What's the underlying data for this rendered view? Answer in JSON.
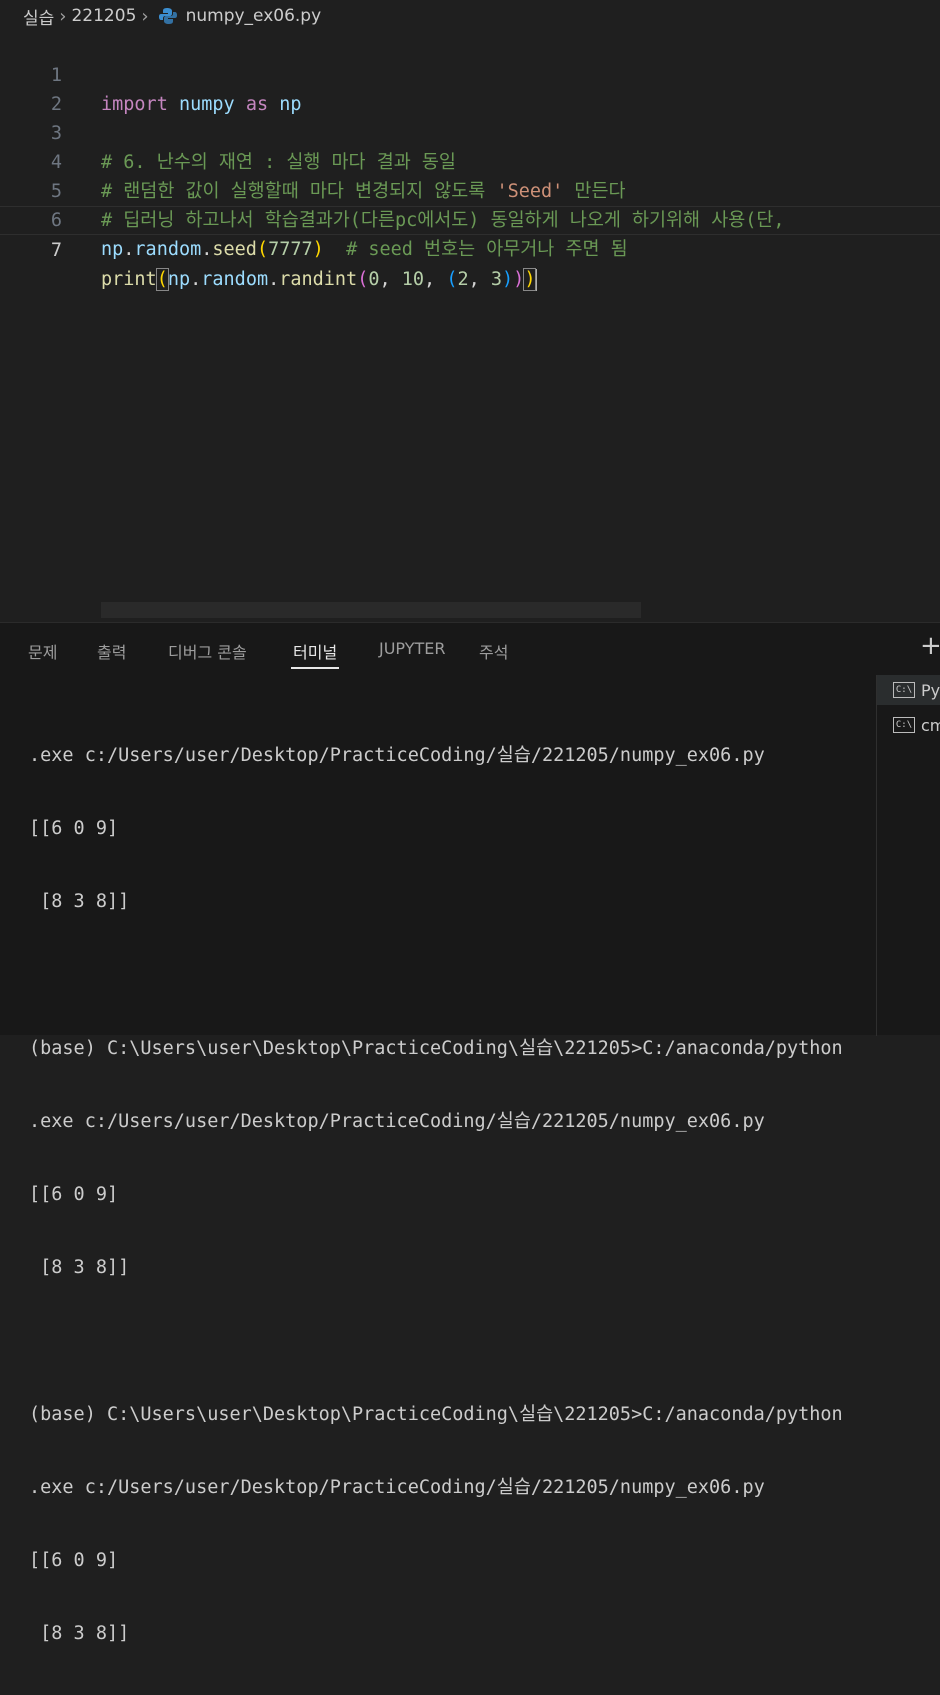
{
  "breadcrumb": {
    "folder1": "실습",
    "folder2": "221205",
    "file": "numpy_ex06.py",
    "file_icon": "python-file-icon"
  },
  "editor": {
    "lines": [
      {
        "num": "1"
      },
      {
        "num": "2"
      },
      {
        "num": "3"
      },
      {
        "num": "4"
      },
      {
        "num": "5"
      },
      {
        "num": "6"
      },
      {
        "num": "7"
      }
    ],
    "tokens": {
      "l1_import": "import",
      "l1_numpy": "numpy",
      "l1_as": "as",
      "l1_np": "np",
      "l3_comment": "# 6. 난수의 재연 : 실행 마다 결과 동일",
      "l4_comment_a": "# 랜덤한 값이 실행할때 마다 변경되지 않도록 ",
      "l4_string": "'Seed'",
      "l4_comment_b": " 만든다",
      "l5_comment": "# 딥러닝 하고나서 학습결과가(다른pc에서도) 동일하게 나오게 하기위해 사용(단,",
      "l6_np": "np",
      "l6_random": "random",
      "l6_seed": "seed",
      "l6_arg": "7777",
      "l6_comment": "# seed 번호는 아무거나 주면 됨",
      "l7_print": "print",
      "l7_np": "np",
      "l7_random": "random",
      "l7_randint": "randint",
      "l7_a0": "0",
      "l7_a1": "10",
      "l7_a2": "2",
      "l7_a3": "3"
    }
  },
  "panel": {
    "tabs": [
      "문제",
      "출력",
      "디버그 콘솔",
      "터미널",
      "JUPYTER",
      "주석"
    ],
    "active_tab": "터미널",
    "add_label": "+",
    "terminal_lines": [
      ".exe c:/Users/user/Desktop/PracticeCoding/실습/221205/numpy_ex06.py",
      "[[6 0 9]",
      " [8 3 8]]",
      "",
      "(base) C:\\Users\\user\\Desktop\\PracticeCoding\\실습\\221205>C:/anaconda/python",
      ".exe c:/Users/user/Desktop/PracticeCoding/실습/221205/numpy_ex06.py",
      "[[6 0 9]",
      " [8 3 8]]",
      "",
      "(base) C:\\Users\\user\\Desktop\\PracticeCoding\\실습\\221205>C:/anaconda/python",
      ".exe c:/Users/user/Desktop/PracticeCoding/실습/221205/numpy_ex06.py",
      "[[6 0 9]",
      " [8 3 8]]"
    ],
    "terminal_list": [
      {
        "label": "Py",
        "icon": "terminal-icon",
        "selected": true
      },
      {
        "label": "cm",
        "icon": "terminal-icon",
        "selected": false
      }
    ]
  },
  "colors": {
    "keyword": "#c586c0",
    "identifier": "#9cdcfe",
    "function": "#dcdcaa",
    "number": "#b5cea8",
    "string": "#ce9178",
    "comment": "#6a9955",
    "background": "#1f1f1f"
  }
}
